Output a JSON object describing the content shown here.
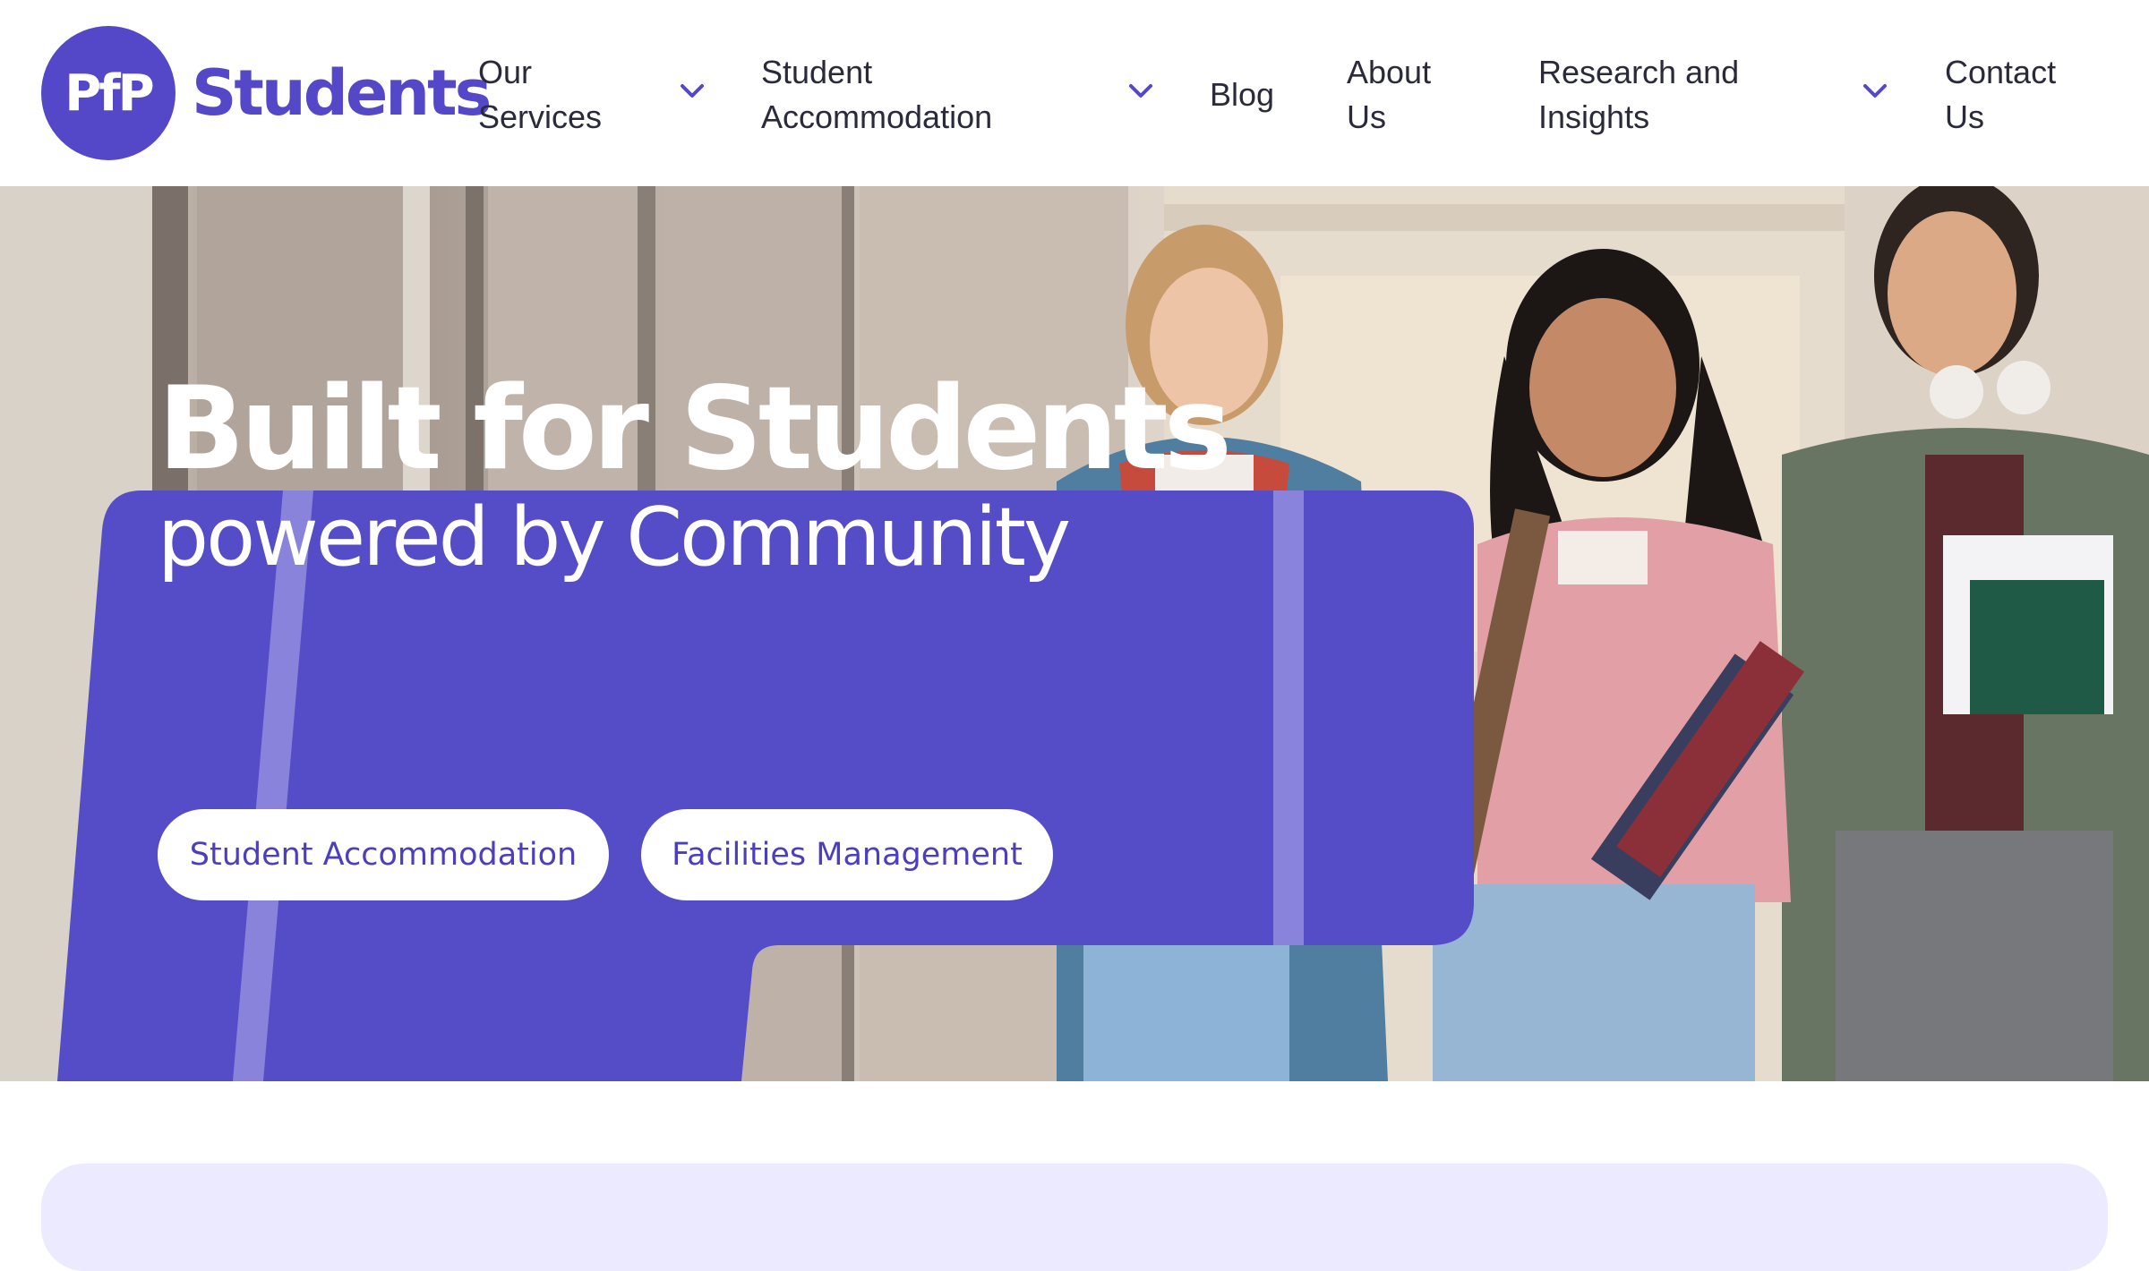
{
  "brand": {
    "logo_mark": "PfP",
    "logo_word": "Students",
    "color": "#5448c8"
  },
  "nav": {
    "items": [
      {
        "label": "Our\nServices",
        "has_dropdown": true
      },
      {
        "label": "Student\nAccommodation",
        "has_dropdown": true
      },
      {
        "label": "Blog",
        "has_dropdown": false
      },
      {
        "label": "About\nUs",
        "has_dropdown": false
      },
      {
        "label": "Research and\nInsights",
        "has_dropdown": true
      },
      {
        "label": "Contact\nUs",
        "has_dropdown": false
      }
    ],
    "dropdown_icon": "chevron-down-icon"
  },
  "hero": {
    "title": "Built for Students",
    "subtitle": "powered by Community",
    "buttons": [
      {
        "label": "Student Accommodation"
      },
      {
        "label": "Facilities Management"
      }
    ],
    "card_color": "#554cc8",
    "image_description": "students-walking-photo"
  },
  "lower_panel": {
    "color": "#eceaff"
  }
}
